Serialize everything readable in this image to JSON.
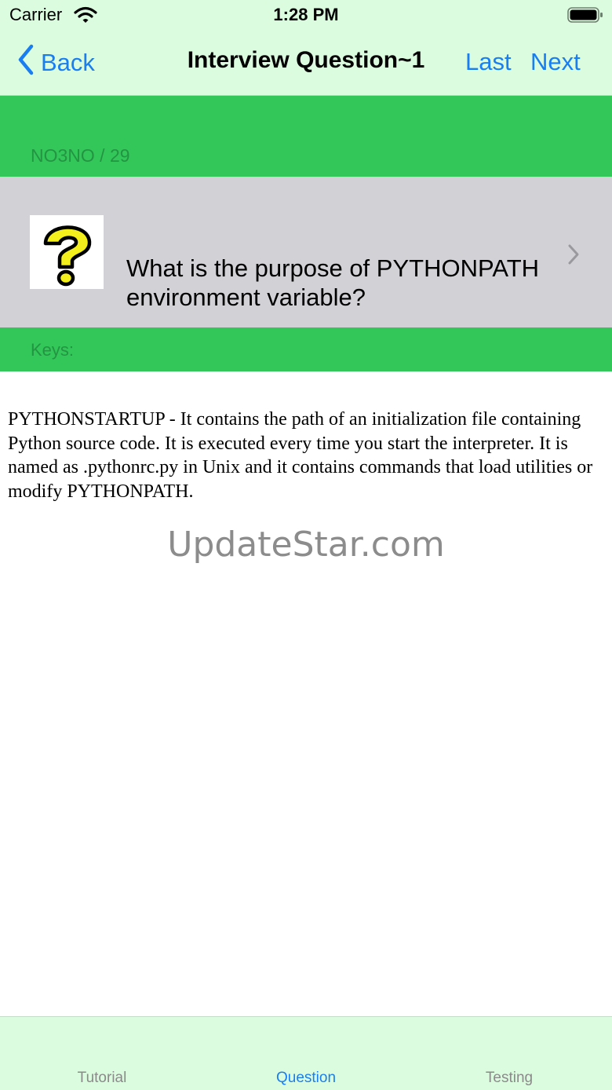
{
  "status_bar": {
    "carrier": "Carrier",
    "time": "1:28 PM"
  },
  "nav": {
    "back_label": "Back",
    "title": "Interview Question~1",
    "last_label": "Last",
    "next_label": "Next"
  },
  "header": {
    "counter": "NO3NO / 29"
  },
  "question": {
    "icon": "question-mark-icon",
    "text": "What is the purpose of PYTHONPATH environment variable?"
  },
  "keys": {
    "label": "Keys:"
  },
  "answer": {
    "text": "PYTHONSTARTUP - It contains the path of an initialization file containing Python source code. It is executed every time you start the interpreter. It is named as .pythonrc.py in Unix and it contains commands that load utilities or modify PYTHONPATH."
  },
  "watermark": "UpdateStar.com",
  "tabs": [
    {
      "label": "Tutorial",
      "selected": false
    },
    {
      "label": "Question",
      "selected": true
    },
    {
      "label": "Testing",
      "selected": false
    }
  ],
  "colors": {
    "accent": "#1a7ef3",
    "bar_background": "#dcfcdf",
    "green_band": "#33c75a",
    "cell_gray": "#d2d2d6",
    "question_mark_yellow": "#f3ef1c"
  }
}
